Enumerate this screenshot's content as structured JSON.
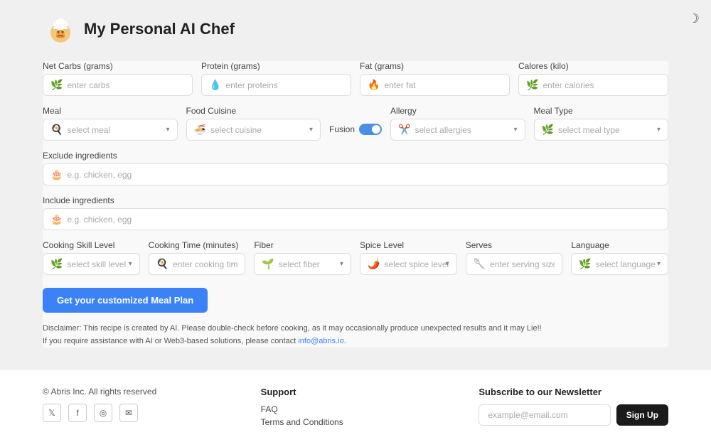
{
  "app": {
    "title": "My Personal AI Chef"
  },
  "darkmode": {
    "icon": "☽"
  },
  "form": {
    "net_carbs": {
      "label": "Net Carbs (grams)",
      "placeholder": "enter carbs",
      "icon": "🌿"
    },
    "protein": {
      "label": "Protein (grams)",
      "placeholder": "enter proteins",
      "icon": "💧"
    },
    "fat": {
      "label": "Fat (grams)",
      "placeholder": "enter fat",
      "icon": "🔥"
    },
    "calories": {
      "label": "Calores (kilo)",
      "placeholder": "enter calories",
      "icon": "🌿"
    },
    "meal": {
      "label": "Meal",
      "placeholder": "select meal",
      "icon": "🍳"
    },
    "food_cuisine": {
      "label": "Food Cuisine",
      "placeholder": "select cuisine",
      "icon": "🍜"
    },
    "fusion": {
      "label": "Fusion"
    },
    "allergy": {
      "label": "Allergy",
      "placeholder": "select allergies",
      "icon": "✂️"
    },
    "meal_type": {
      "label": "Meal Type",
      "placeholder": "select meal type",
      "icon": "🌿"
    },
    "exclude": {
      "label": "Exclude ingredients",
      "placeholder": "e.g. chicken, egg",
      "icon": "🎂"
    },
    "include": {
      "label": "Include ingredients",
      "placeholder": "e.g. chicken, egg",
      "icon": "🎂"
    },
    "cooking_skill": {
      "label": "Cooking Skill Level",
      "placeholder": "select skill level",
      "icon": "🌿"
    },
    "cooking_time": {
      "label": "Cooking Time (minutes)",
      "placeholder": "enter cooking time",
      "icon": "🍳"
    },
    "fiber": {
      "label": "Fiber",
      "placeholder": "select fiber",
      "icon": "🌱"
    },
    "spice_level": {
      "label": "Spice Level",
      "placeholder": "select spice level",
      "icon": "🌶️"
    },
    "serves": {
      "label": "Serves",
      "placeholder": "enter serving size",
      "icon": "🥄"
    },
    "language": {
      "label": "Language",
      "placeholder": "select language",
      "icon": "🌿"
    },
    "submit_label": "Get your customized Meal Plan"
  },
  "disclaimer": {
    "line1": "Disclaimer: This recipe is created by AI. Please double-check before cooking, as it may occasionally produce unexpected results and it may Lie!!",
    "line2": "If you require assistance with AI or Web3-based solutions, please contact ",
    "link_text": "info@abris.io",
    "link_href": "mailto:info@abris.io",
    "line2_end": "."
  },
  "footer": {
    "copy": "© Abris Inc. All rights reserved",
    "social": [
      {
        "name": "twitter",
        "icon": "𝕏"
      },
      {
        "name": "facebook",
        "icon": "f"
      },
      {
        "name": "instagram",
        "icon": "◎"
      },
      {
        "name": "email",
        "icon": "✉"
      }
    ],
    "support": {
      "title": "Support",
      "links": [
        "FAQ",
        "Terms and Conditions"
      ]
    },
    "newsletter": {
      "title": "Subscribe to our Newsletter",
      "placeholder": "example@email.com",
      "button_label": "Sign Up"
    }
  }
}
